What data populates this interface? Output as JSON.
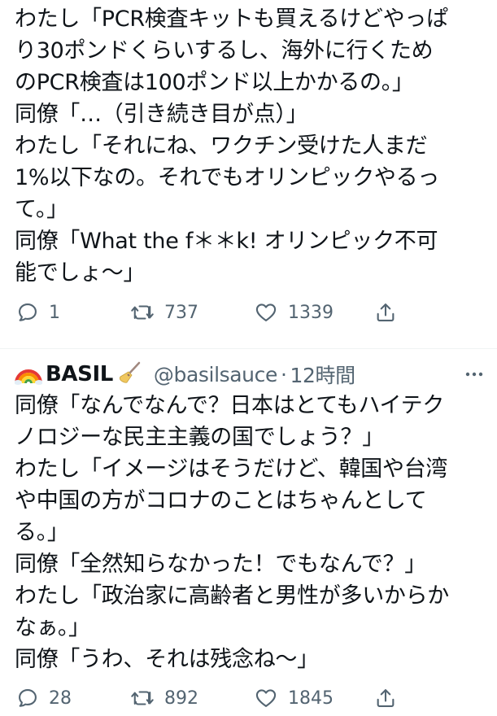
{
  "tweet1": {
    "lines": [
      "わたし「PCR検査キットも買えるけどやっぱ",
      "り30ポンドくらいするし、海外に行くため",
      "のPCR検査は100ポンド以上かかるの。」",
      "同僚「…（引き続き目が点）」",
      "わたし「それにね、ワクチン受けた人まだ",
      "1%以下なの。それでもオリンピックやるっ",
      "て。」",
      "同僚「What the f＊＊k! オリンピック不可",
      "能でしょ〜」"
    ],
    "actions": {
      "reply_count": "1",
      "retweet_count": "737",
      "like_count": "1339"
    }
  },
  "tweet2": {
    "author": {
      "name": "BASIL",
      "handle": "@basilsauce",
      "separator": "·",
      "time": "12時間"
    },
    "lines": [
      "同僚「なんでなんで？日本はとてもハイテク",
      "ノロジーな民主主義の国でしょう？」",
      "わたし「イメージはそうだけど、韓国や台湾",
      "や中国の方がコロナのことはちゃんとして",
      "る。」",
      "同僚「全然知らなかった！でもなんで？」",
      "わたし「政治家に高齢者と男性が多いからか",
      "なぁ。」",
      "同僚「うわ、それは残念ね〜」"
    ],
    "actions": {
      "reply_count": "28",
      "retweet_count": "892",
      "like_count": "1845"
    }
  },
  "icons": {
    "reply": "reply-icon",
    "retweet": "retweet-icon",
    "like": "heart-icon",
    "share": "share-icon",
    "rainbow": "rainbow-emoji-icon",
    "broom": "broom-emoji-icon",
    "more": "more-icon"
  },
  "colors": {
    "text": "#0f1419",
    "secondary": "#536471"
  }
}
